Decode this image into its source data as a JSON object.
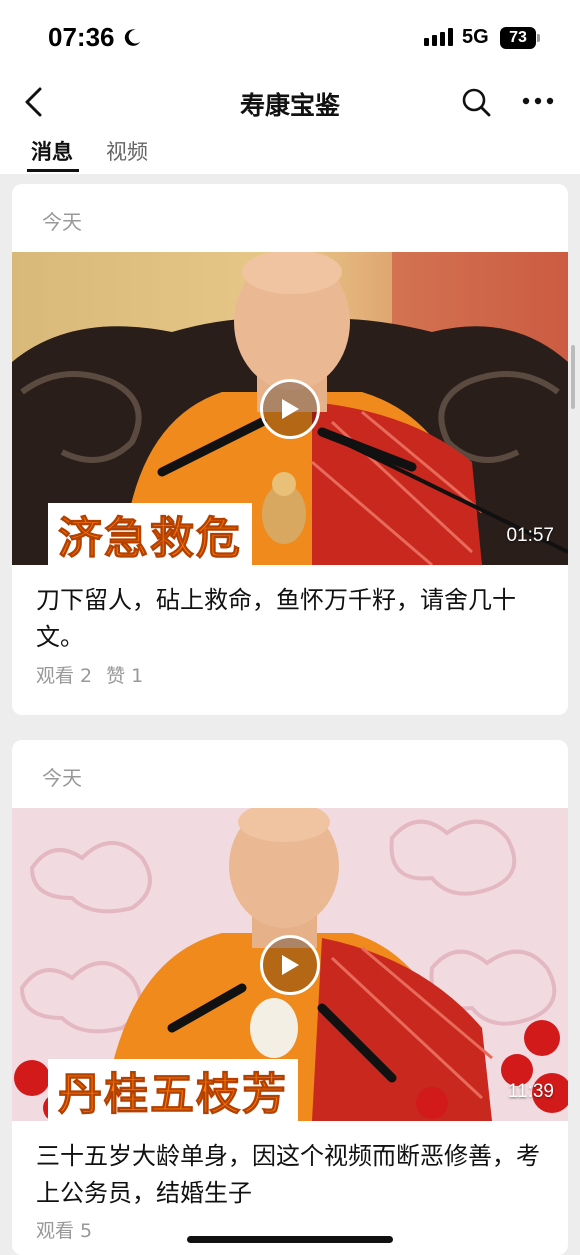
{
  "status_bar": {
    "time": "07:36",
    "network": "5G",
    "battery": "73"
  },
  "nav": {
    "title": "寿康宝鉴"
  },
  "tabs": [
    {
      "label": "消息",
      "active": true
    },
    {
      "label": "视频",
      "active": false
    }
  ],
  "posts": [
    {
      "date": "今天",
      "thumbnail_caption": "济急救危",
      "duration": "01:57",
      "title": "刀下留人，砧上救命，鱼怀万千籽，请舍几十文。",
      "views": "观看 2",
      "likes": "赞 1"
    },
    {
      "date": "今天",
      "thumbnail_caption": "丹桂五枝芳",
      "duration": "11:39",
      "title": "三十五岁大龄单身，因这个视频而断恶修善，考上公务员，结婚生子",
      "views": "观看 5"
    }
  ],
  "icons": {
    "back": "chevron-left-icon",
    "search": "search-icon",
    "more": "more-icon",
    "play": "play-icon",
    "moon": "moon-icon"
  },
  "colors": {
    "caption_text": "#ff7a00",
    "robe_orange": "#f08a1c",
    "robe_red": "#c8281e"
  }
}
